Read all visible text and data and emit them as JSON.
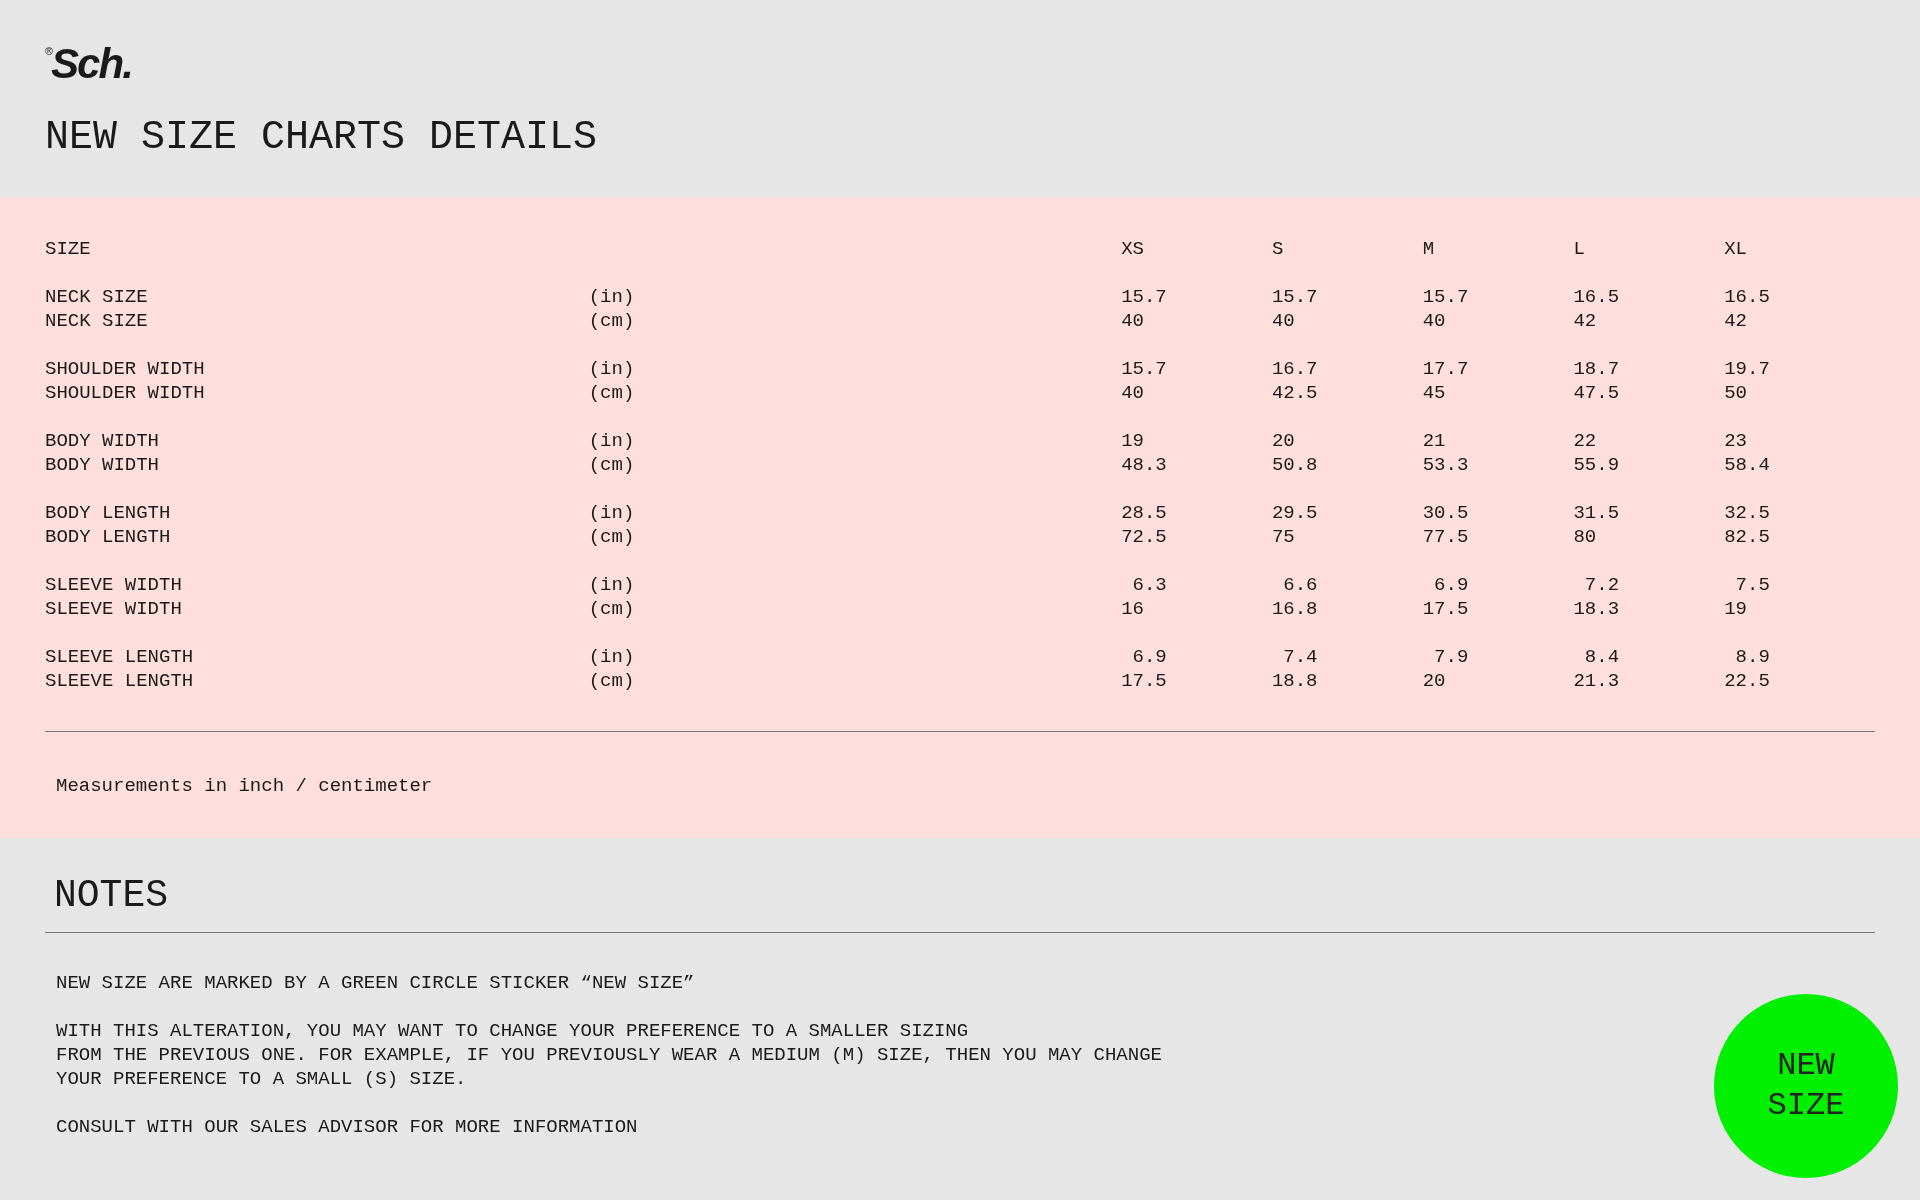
{
  "logo": {
    "mark": "®",
    "text": "Sch."
  },
  "title": "NEW SIZE CHARTS DETAILS",
  "size_table": {
    "header": "SIZE",
    "sizes": [
      "XS",
      "S",
      "M",
      "L",
      "XL"
    ],
    "groups": [
      {
        "rows": [
          {
            "label": "NECK SIZE",
            "unit": "(in)",
            "values": [
              "15.7",
              "15.7",
              "15.7",
              "16.5",
              "16.5"
            ]
          },
          {
            "label": "NECK SIZE",
            "unit": "(cm)",
            "values": [
              "40",
              "40",
              "40",
              "42",
              "42"
            ]
          }
        ]
      },
      {
        "rows": [
          {
            "label": "SHOULDER WIDTH",
            "unit": "(in)",
            "values": [
              "15.7",
              "16.7",
              "17.7",
              "18.7",
              "19.7"
            ]
          },
          {
            "label": "SHOULDER WIDTH",
            "unit": "(cm)",
            "values": [
              "40",
              "42.5",
              "45",
              "47.5",
              "50"
            ]
          }
        ]
      },
      {
        "rows": [
          {
            "label": "BODY WIDTH",
            "unit": "(in)",
            "values": [
              "19",
              "20",
              "21",
              "22",
              "23"
            ]
          },
          {
            "label": "BODY WIDTH",
            "unit": "(cm)",
            "values": [
              "48.3",
              "50.8",
              "53.3",
              "55.9",
              "58.4"
            ]
          }
        ]
      },
      {
        "rows": [
          {
            "label": "BODY LENGTH",
            "unit": "(in)",
            "values": [
              "28.5",
              "29.5",
              "30.5",
              "31.5",
              "32.5"
            ]
          },
          {
            "label": "BODY LENGTH",
            "unit": "(cm)",
            "values": [
              "72.5",
              "75",
              "77.5",
              "80",
              "82.5"
            ]
          }
        ]
      },
      {
        "rows": [
          {
            "label": "SLEEVE WIDTH",
            "unit": "(in)",
            "values": [
              " 6.3",
              " 6.6",
              " 6.9",
              " 7.2",
              " 7.5"
            ]
          },
          {
            "label": "SLEEVE WIDTH",
            "unit": "(cm)",
            "values": [
              "16",
              "16.8",
              "17.5",
              "18.3",
              "19"
            ]
          }
        ]
      },
      {
        "rows": [
          {
            "label": "SLEEVE LENGTH",
            "unit": "(in)",
            "values": [
              " 6.9",
              " 7.4",
              " 7.9",
              " 8.4",
              " 8.9"
            ]
          },
          {
            "label": "SLEEVE LENGTH",
            "unit": "(cm)",
            "values": [
              "17.5",
              "18.8",
              "20",
              "21.3",
              "22.5"
            ]
          }
        ]
      }
    ],
    "footnote": "Measurements in inch / centimeter"
  },
  "notes": {
    "title": "NOTES",
    "paragraphs": [
      [
        "NEW SIZE ARE MARKED BY A GREEN CIRCLE STICKER “NEW SIZE”"
      ],
      [
        "WITH THIS ALTERATION, YOU MAY WANT TO CHANGE YOUR PREFERENCE TO A SMALLER SIZING",
        "FROM THE PREVIOUS ONE. FOR EXAMPLE, IF YOU PREVIOUSLY WEAR A MEDIUM (M) SIZE, THEN YOU MAY CHANGE",
        "YOUR PREFERENCE TO A SMALL (S) SIZE."
      ],
      [
        "CONSULT WITH OUR SALES ADVISOR FOR MORE INFORMATION"
      ]
    ],
    "sticker": {
      "lines": [
        "NEW",
        "SIZE"
      ],
      "color": "#00f000"
    }
  }
}
